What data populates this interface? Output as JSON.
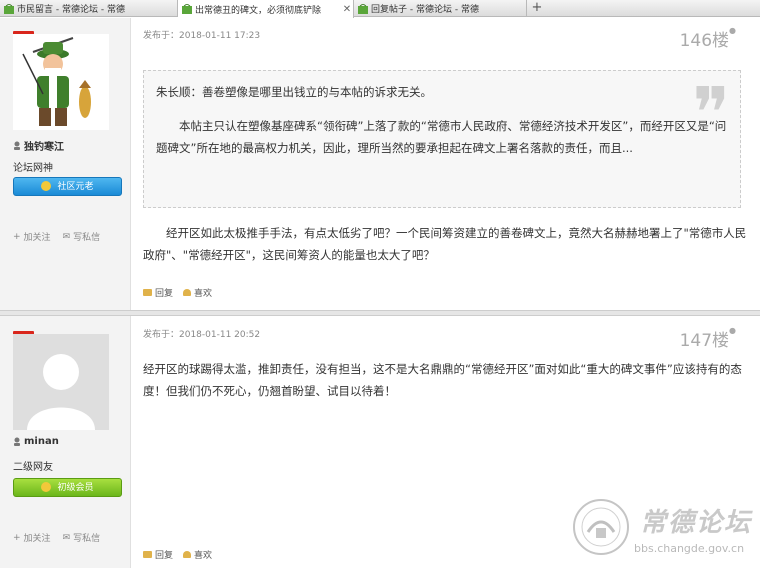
{
  "tabs": [
    {
      "title": "市民留言 - 常德论坛 - 常德",
      "active": false
    },
    {
      "title": "出常德丑的碑文，必须彻底铲除",
      "active": true
    },
    {
      "title": "回复帖子 - 常德论坛 - 常德",
      "active": false
    }
  ],
  "posts": [
    {
      "username": "独钓寒江",
      "rank": "论坛网神",
      "badge": "社区元老",
      "follow": "加关注",
      "message": "写私信",
      "posted_at": "发布于：2018-01-11 17:23",
      "floor": "146楼",
      "quote_line1": "朱长顺：善卷塑像是哪里出钱立的与本帖的诉求无关。",
      "quote_line2": "本帖主只认在塑像基座碑系“领衔碑”上落了款的“常德市人民政府、常德经济技术开发区”，而经开区又是“问题碑文”所在地的最高权力机关，因此，理所当然的要承担起在碑文上署名落款的责任，而且...",
      "body": "经开区如此太极推手手法，有点太低劣了吧？一个民间筹资建立的善卷碑文上，竟然大名赫赫地署上了\"常德市人民政府\"、\"常德经开区\"，这民间筹资人的能量也太大了吧？",
      "reply": "回复",
      "like": "喜欢"
    },
    {
      "username": "minan",
      "rank": "二级网友",
      "badge": "初级会员",
      "follow": "加关注",
      "message": "写私信",
      "posted_at": "发布于：2018-01-11 20:52",
      "floor": "147楼",
      "body": "经开区的球踢得太滥，推卸责任，没有担当，这不是大名鼎鼎的“常德经开区”面对如此“重大的碑文事件”应该持有的态度！但我们仍不死心，仍翘首盼望、试目以待着！",
      "reply": "回复",
      "like": "喜欢"
    }
  ],
  "watermark": {
    "name": "常德论坛",
    "url": "bbs.changde.gov.cn",
    "seal_text": "bbs.changde.gov.cn"
  },
  "colors": {
    "sidebar": "#f3f3f3",
    "badge_blue": "#1a8ad6",
    "badge_green": "#6bb61b",
    "floor_text": "#aaaaaa"
  }
}
